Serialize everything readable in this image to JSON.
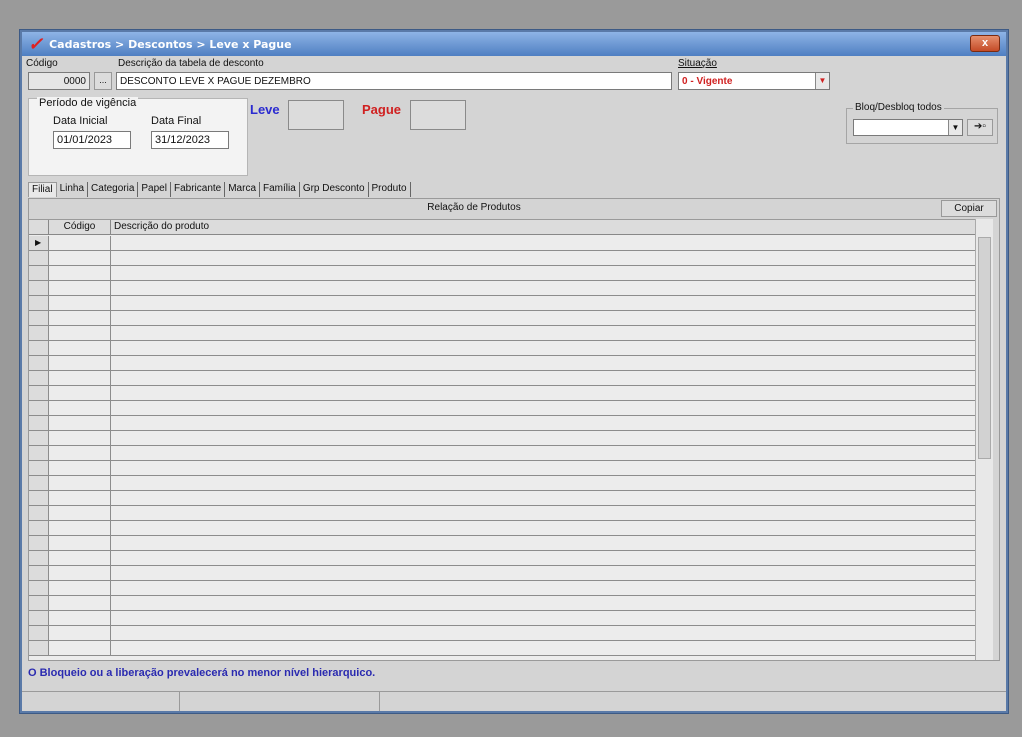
{
  "window": {
    "title": "Cadastros > Descontos > Leve x Pague",
    "close_label": "x"
  },
  "header": {
    "codigo_label": "Código",
    "codigo_value": "0000",
    "lookup_label": "...",
    "descricao_label": "Descrição da tabela de desconto",
    "descricao_value": "DESCONTO LEVE X PAGUE DEZEMBRO",
    "situacao_label": "Situação",
    "situacao_value": "0 - Vigente"
  },
  "periodo": {
    "legend": "Período de vigência",
    "data_inicial_label": "Data Inicial",
    "data_inicial_value": "01/01/2023",
    "data_final_label": "Data Final",
    "data_final_value": "31/12/2023"
  },
  "leve_label": "Leve",
  "pague_label": "Pague",
  "bloq": {
    "legend": "Bloq/Desbloq todos",
    "value": ""
  },
  "tabs": [
    "Filial",
    "Linha",
    "Categoria",
    "Papel",
    "Fabricante",
    "Marca",
    "Família",
    "Grp Desconto",
    "Produto"
  ],
  "relacao_header": "Relação de Produtos",
  "copiar_label": "Copiar",
  "grid": {
    "col_codigo": "Código",
    "col_descricao": "Descrição do produto"
  },
  "info_message": "O Bloqueio ou a liberação prevalecerá no menor nível hierarquico.",
  "colors": {
    "leve": "#2b2bd0",
    "pague": "#d02020",
    "situacao": "#d02020",
    "info": "#2a2ab0"
  }
}
